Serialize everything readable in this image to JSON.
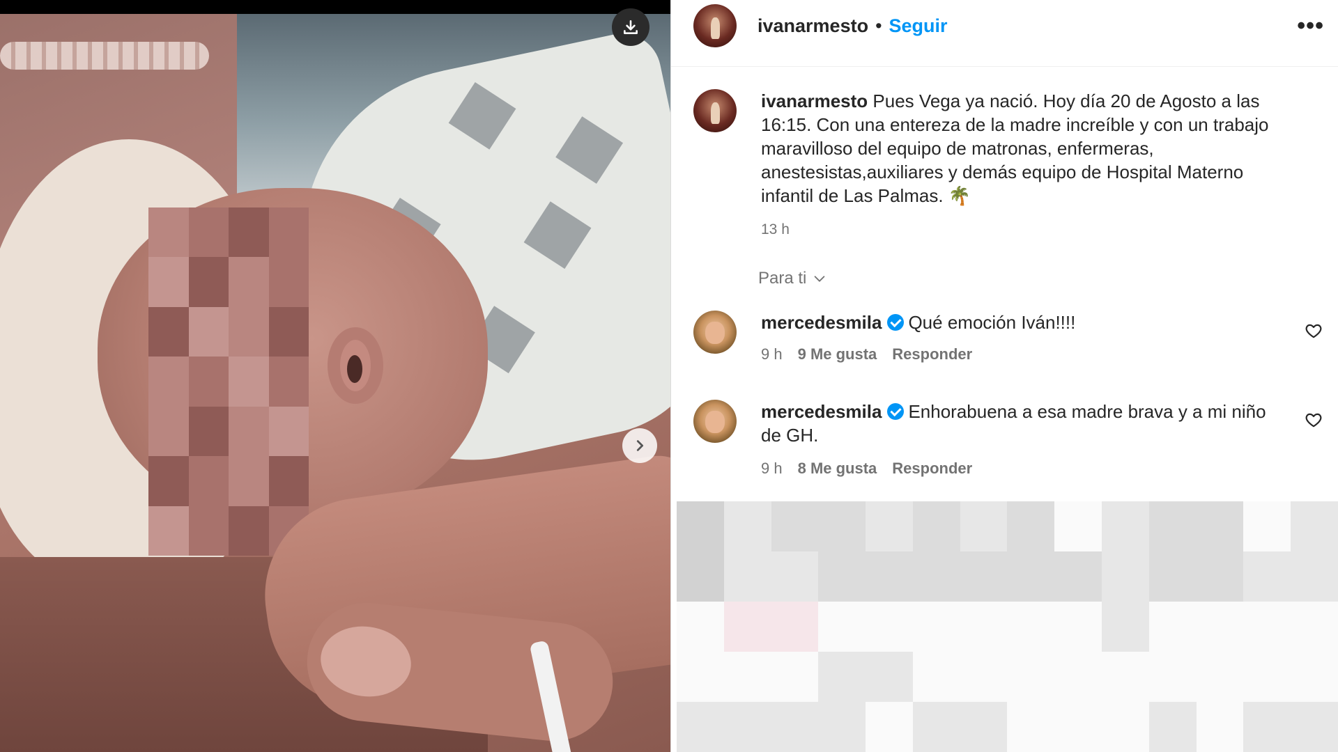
{
  "post": {
    "author": "ivanarmesto",
    "separator": "•",
    "follow_label": "Seguir",
    "more_label": "•••",
    "caption_author": "ivanarmesto",
    "caption_text": "Pues Vega ya nació. Hoy día 20 de Agosto a las 16:15. Con una entereza de la madre increíble y con un trabajo maravilloso del equipo de matronas, enfermeras, anestesistas,auxiliares y demás equipo de Hospital Materno infantil de Las Palmas. 🌴",
    "time": "13 h",
    "sort_label": "Para ti"
  },
  "comments": [
    {
      "author": "mercedesmila",
      "verified": true,
      "text": "Qué emoción Iván!!!!",
      "time": "9 h",
      "likes": "9 Me gusta",
      "reply": "Responder"
    },
    {
      "author": "mercedesmila",
      "verified": true,
      "text": "Enhorabuena a esa madre brava y a mi niño de GH.",
      "time": "9 h",
      "likes": "8 Me gusta",
      "reply": "Responder"
    }
  ],
  "colors": {
    "accent": "#0095f6",
    "secondary_text": "#737373",
    "primary_text": "#262626"
  },
  "icons": {
    "download": "download-icon",
    "next": "chevron-right-icon",
    "heart": "heart-outline-icon",
    "sort": "chevron-down-icon",
    "verified": "verified-badge-icon"
  }
}
